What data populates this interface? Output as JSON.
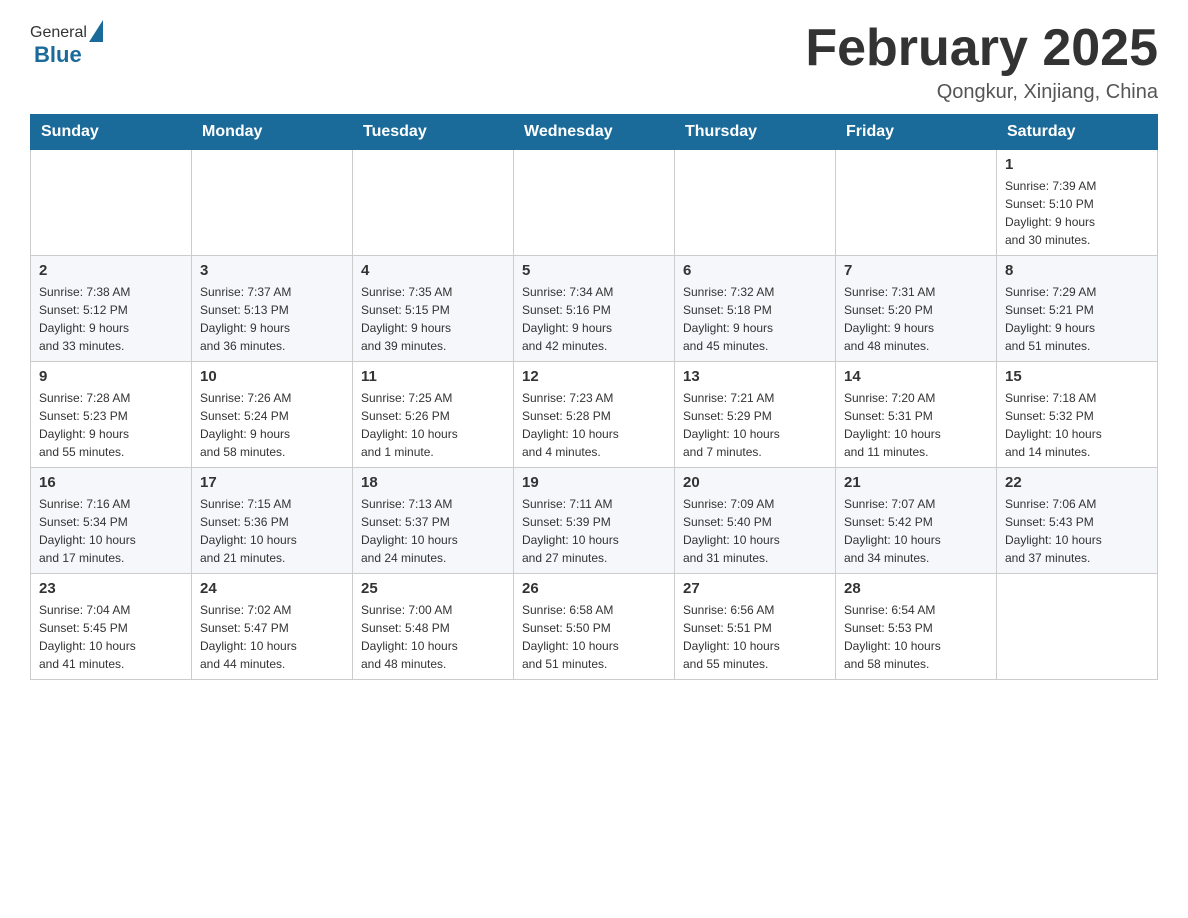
{
  "header": {
    "logo_general": "General",
    "logo_blue": "Blue",
    "month_title": "February 2025",
    "location": "Qongkur, Xinjiang, China"
  },
  "weekdays": [
    "Sunday",
    "Monday",
    "Tuesday",
    "Wednesday",
    "Thursday",
    "Friday",
    "Saturday"
  ],
  "weeks": [
    [
      {
        "day": "",
        "info": ""
      },
      {
        "day": "",
        "info": ""
      },
      {
        "day": "",
        "info": ""
      },
      {
        "day": "",
        "info": ""
      },
      {
        "day": "",
        "info": ""
      },
      {
        "day": "",
        "info": ""
      },
      {
        "day": "1",
        "info": "Sunrise: 7:39 AM\nSunset: 5:10 PM\nDaylight: 9 hours\nand 30 minutes."
      }
    ],
    [
      {
        "day": "2",
        "info": "Sunrise: 7:38 AM\nSunset: 5:12 PM\nDaylight: 9 hours\nand 33 minutes."
      },
      {
        "day": "3",
        "info": "Sunrise: 7:37 AM\nSunset: 5:13 PM\nDaylight: 9 hours\nand 36 minutes."
      },
      {
        "day": "4",
        "info": "Sunrise: 7:35 AM\nSunset: 5:15 PM\nDaylight: 9 hours\nand 39 minutes."
      },
      {
        "day": "5",
        "info": "Sunrise: 7:34 AM\nSunset: 5:16 PM\nDaylight: 9 hours\nand 42 minutes."
      },
      {
        "day": "6",
        "info": "Sunrise: 7:32 AM\nSunset: 5:18 PM\nDaylight: 9 hours\nand 45 minutes."
      },
      {
        "day": "7",
        "info": "Sunrise: 7:31 AM\nSunset: 5:20 PM\nDaylight: 9 hours\nand 48 minutes."
      },
      {
        "day": "8",
        "info": "Sunrise: 7:29 AM\nSunset: 5:21 PM\nDaylight: 9 hours\nand 51 minutes."
      }
    ],
    [
      {
        "day": "9",
        "info": "Sunrise: 7:28 AM\nSunset: 5:23 PM\nDaylight: 9 hours\nand 55 minutes."
      },
      {
        "day": "10",
        "info": "Sunrise: 7:26 AM\nSunset: 5:24 PM\nDaylight: 9 hours\nand 58 minutes."
      },
      {
        "day": "11",
        "info": "Sunrise: 7:25 AM\nSunset: 5:26 PM\nDaylight: 10 hours\nand 1 minute."
      },
      {
        "day": "12",
        "info": "Sunrise: 7:23 AM\nSunset: 5:28 PM\nDaylight: 10 hours\nand 4 minutes."
      },
      {
        "day": "13",
        "info": "Sunrise: 7:21 AM\nSunset: 5:29 PM\nDaylight: 10 hours\nand 7 minutes."
      },
      {
        "day": "14",
        "info": "Sunrise: 7:20 AM\nSunset: 5:31 PM\nDaylight: 10 hours\nand 11 minutes."
      },
      {
        "day": "15",
        "info": "Sunrise: 7:18 AM\nSunset: 5:32 PM\nDaylight: 10 hours\nand 14 minutes."
      }
    ],
    [
      {
        "day": "16",
        "info": "Sunrise: 7:16 AM\nSunset: 5:34 PM\nDaylight: 10 hours\nand 17 minutes."
      },
      {
        "day": "17",
        "info": "Sunrise: 7:15 AM\nSunset: 5:36 PM\nDaylight: 10 hours\nand 21 minutes."
      },
      {
        "day": "18",
        "info": "Sunrise: 7:13 AM\nSunset: 5:37 PM\nDaylight: 10 hours\nand 24 minutes."
      },
      {
        "day": "19",
        "info": "Sunrise: 7:11 AM\nSunset: 5:39 PM\nDaylight: 10 hours\nand 27 minutes."
      },
      {
        "day": "20",
        "info": "Sunrise: 7:09 AM\nSunset: 5:40 PM\nDaylight: 10 hours\nand 31 minutes."
      },
      {
        "day": "21",
        "info": "Sunrise: 7:07 AM\nSunset: 5:42 PM\nDaylight: 10 hours\nand 34 minutes."
      },
      {
        "day": "22",
        "info": "Sunrise: 7:06 AM\nSunset: 5:43 PM\nDaylight: 10 hours\nand 37 minutes."
      }
    ],
    [
      {
        "day": "23",
        "info": "Sunrise: 7:04 AM\nSunset: 5:45 PM\nDaylight: 10 hours\nand 41 minutes."
      },
      {
        "day": "24",
        "info": "Sunrise: 7:02 AM\nSunset: 5:47 PM\nDaylight: 10 hours\nand 44 minutes."
      },
      {
        "day": "25",
        "info": "Sunrise: 7:00 AM\nSunset: 5:48 PM\nDaylight: 10 hours\nand 48 minutes."
      },
      {
        "day": "26",
        "info": "Sunrise: 6:58 AM\nSunset: 5:50 PM\nDaylight: 10 hours\nand 51 minutes."
      },
      {
        "day": "27",
        "info": "Sunrise: 6:56 AM\nSunset: 5:51 PM\nDaylight: 10 hours\nand 55 minutes."
      },
      {
        "day": "28",
        "info": "Sunrise: 6:54 AM\nSunset: 5:53 PM\nDaylight: 10 hours\nand 58 minutes."
      },
      {
        "day": "",
        "info": ""
      }
    ]
  ]
}
